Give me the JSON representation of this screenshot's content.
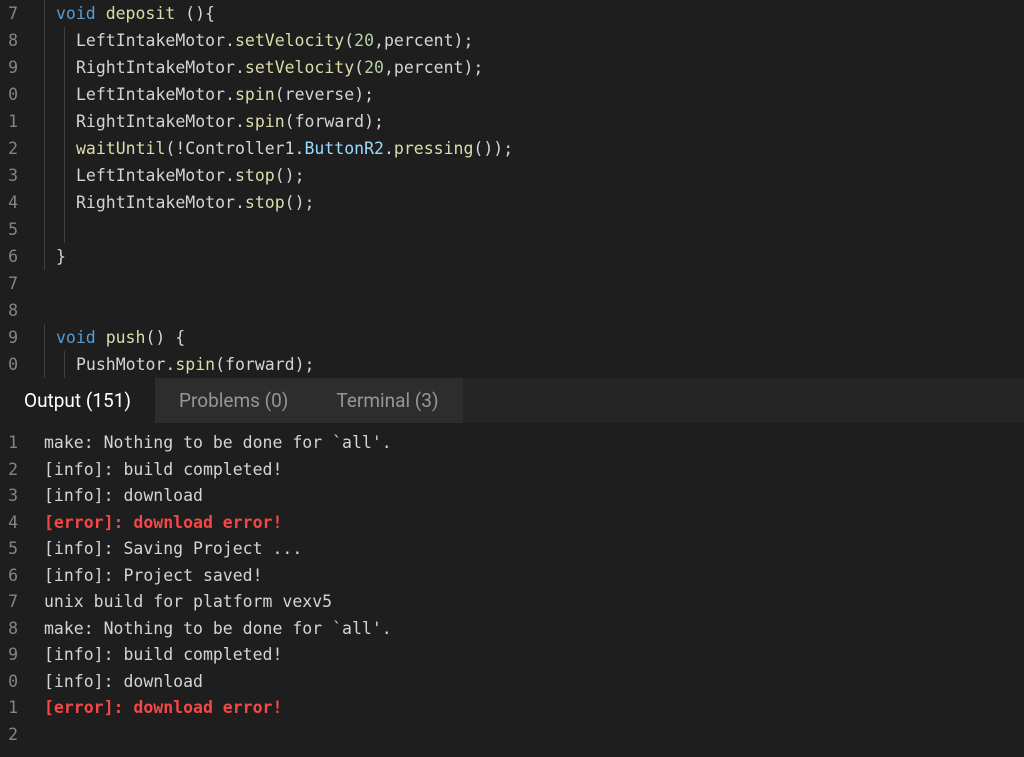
{
  "code_lines": [
    {
      "ln": "7",
      "indent": 1,
      "tokens": [
        {
          "t": "kw",
          "v": "void"
        },
        {
          "t": "plain",
          "v": " "
        },
        {
          "t": "fn",
          "v": "deposit"
        },
        {
          "t": "plain",
          "v": " "
        },
        {
          "t": "pt",
          "v": "(){"
        }
      ]
    },
    {
      "ln": "8",
      "indent": 2,
      "tokens": [
        {
          "t": "plain",
          "v": "LeftIntakeMotor."
        },
        {
          "t": "fn",
          "v": "setVelocity"
        },
        {
          "t": "pt",
          "v": "("
        },
        {
          "t": "num",
          "v": "20"
        },
        {
          "t": "pt",
          "v": ","
        },
        {
          "t": "plain",
          "v": "percent"
        },
        {
          "t": "pt",
          "v": ");"
        }
      ]
    },
    {
      "ln": "9",
      "indent": 2,
      "tokens": [
        {
          "t": "plain",
          "v": "RightIntakeMotor."
        },
        {
          "t": "fn",
          "v": "setVelocity"
        },
        {
          "t": "pt",
          "v": "("
        },
        {
          "t": "num",
          "v": "20"
        },
        {
          "t": "pt",
          "v": ","
        },
        {
          "t": "plain",
          "v": "percent"
        },
        {
          "t": "pt",
          "v": ");"
        }
      ]
    },
    {
      "ln": "0",
      "indent": 2,
      "tokens": [
        {
          "t": "plain",
          "v": "LeftIntakeMotor."
        },
        {
          "t": "fn",
          "v": "spin"
        },
        {
          "t": "pt",
          "v": "("
        },
        {
          "t": "plain",
          "v": "reverse"
        },
        {
          "t": "pt",
          "v": ");"
        }
      ]
    },
    {
      "ln": "1",
      "indent": 2,
      "tokens": [
        {
          "t": "plain",
          "v": "RightIntakeMotor."
        },
        {
          "t": "fn",
          "v": "spin"
        },
        {
          "t": "pt",
          "v": "("
        },
        {
          "t": "plain",
          "v": "forward"
        },
        {
          "t": "pt",
          "v": ");"
        }
      ]
    },
    {
      "ln": "2",
      "indent": 2,
      "tokens": [
        {
          "t": "fn",
          "v": "waitUntil"
        },
        {
          "t": "pt",
          "v": "(!"
        },
        {
          "t": "plain",
          "v": "Controller1."
        },
        {
          "t": "var",
          "v": "ButtonR2"
        },
        {
          "t": "plain",
          "v": "."
        },
        {
          "t": "fn",
          "v": "pressing"
        },
        {
          "t": "pt",
          "v": "());"
        }
      ]
    },
    {
      "ln": "3",
      "indent": 2,
      "tokens": [
        {
          "t": "plain",
          "v": "LeftIntakeMotor."
        },
        {
          "t": "fn",
          "v": "stop"
        },
        {
          "t": "pt",
          "v": "();"
        }
      ]
    },
    {
      "ln": "4",
      "indent": 2,
      "tokens": [
        {
          "t": "plain",
          "v": "RightIntakeMotor."
        },
        {
          "t": "fn",
          "v": "stop"
        },
        {
          "t": "pt",
          "v": "();"
        }
      ]
    },
    {
      "ln": "5",
      "indent": 2,
      "tokens": []
    },
    {
      "ln": "6",
      "indent": 1,
      "tokens": [
        {
          "t": "pt",
          "v": "}"
        }
      ]
    },
    {
      "ln": "7",
      "indent": 0,
      "tokens": []
    },
    {
      "ln": "8",
      "indent": 0,
      "tokens": []
    },
    {
      "ln": "9",
      "indent": 1,
      "tokens": [
        {
          "t": "kw",
          "v": "void"
        },
        {
          "t": "plain",
          "v": " "
        },
        {
          "t": "fn",
          "v": "push"
        },
        {
          "t": "pt",
          "v": "() {"
        }
      ]
    },
    {
      "ln": "0",
      "indent": 2,
      "tokens": [
        {
          "t": "plain",
          "v": "PushMotor."
        },
        {
          "t": "fn",
          "v": "spin"
        },
        {
          "t": "pt",
          "v": "("
        },
        {
          "t": "plain",
          "v": "forward"
        },
        {
          "t": "pt",
          "v": ");"
        }
      ]
    }
  ],
  "tabs": [
    {
      "label": "Output (151)",
      "active": true
    },
    {
      "label": "Problems (0)",
      "active": false
    },
    {
      "label": "Terminal (3)",
      "active": false
    }
  ],
  "output_lines": [
    {
      "ln": "1",
      "cls": "",
      "text": "make: Nothing to be done for `all'."
    },
    {
      "ln": "2",
      "cls": "",
      "text": "[info]: build completed!"
    },
    {
      "ln": "3",
      "cls": "",
      "text": "[info]: download"
    },
    {
      "ln": "4",
      "cls": "err",
      "text": "[error]: download error!"
    },
    {
      "ln": "5",
      "cls": "",
      "text": "[info]: Saving Project ..."
    },
    {
      "ln": "6",
      "cls": "",
      "text": "[info]: Project saved!"
    },
    {
      "ln": "7",
      "cls": "",
      "text": "unix build for platform vexv5"
    },
    {
      "ln": "8",
      "cls": "",
      "text": "make: Nothing to be done for `all'."
    },
    {
      "ln": "9",
      "cls": "",
      "text": "[info]: build completed!"
    },
    {
      "ln": "0",
      "cls": "",
      "text": "[info]: download"
    },
    {
      "ln": "1",
      "cls": "err",
      "text": "[error]: download error!"
    },
    {
      "ln": "2",
      "cls": "",
      "text": ""
    }
  ]
}
